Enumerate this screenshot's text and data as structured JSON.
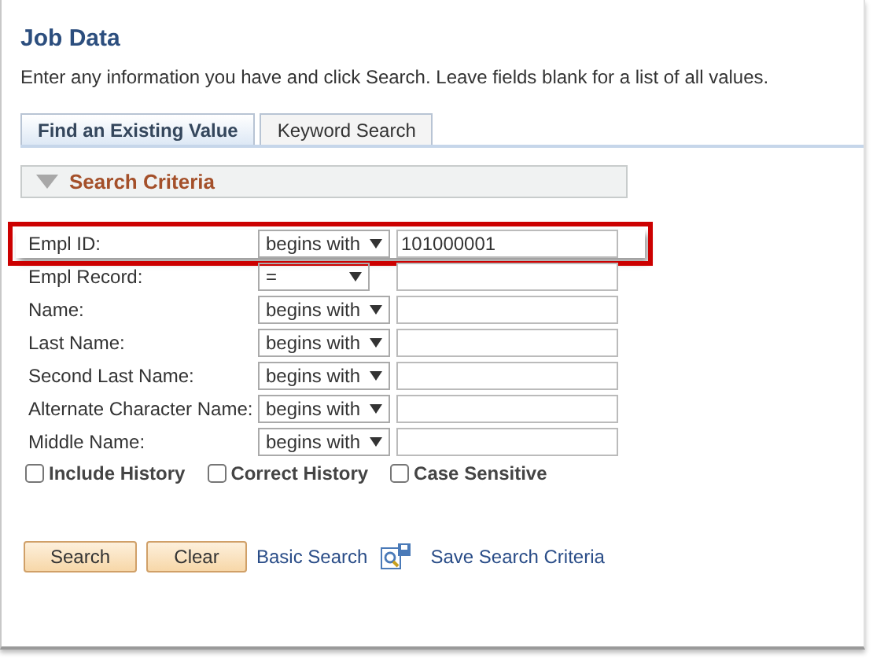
{
  "page": {
    "title": "Job Data",
    "instructions": "Enter any information you have and click Search. Leave fields blank for a list of all values."
  },
  "tabs": [
    {
      "label": "Find an Existing Value",
      "selected": true
    },
    {
      "label": "Keyword Search",
      "selected": false
    }
  ],
  "section": {
    "title": "Search Criteria",
    "expanded": true
  },
  "fields": [
    {
      "label": "Empl ID:",
      "operator": "begins with",
      "kind": "wide",
      "value": "101000001",
      "highlighted": true
    },
    {
      "label": "Empl Record:",
      "operator": "=",
      "kind": "narrow",
      "highlighted": false
    },
    {
      "label": "Name:",
      "operator": "begins with",
      "kind": "wide",
      "highlighted": false
    },
    {
      "label": "Last Name:",
      "operator": "begins with",
      "kind": "wide",
      "highlighted": false
    },
    {
      "label": "Second Last Name:",
      "operator": "begins with",
      "kind": "wide",
      "highlighted": false
    },
    {
      "label": "Alternate Character Name:",
      "operator": "begins with",
      "kind": "wide",
      "highlighted": false
    },
    {
      "label": "Middle Name:",
      "operator": "begins with",
      "kind": "wide",
      "highlighted": false
    }
  ],
  "options": [
    {
      "label": "Include History",
      "checked": false
    },
    {
      "label": "Correct History",
      "checked": false
    },
    {
      "label": "Case Sensitive",
      "checked": false
    }
  ],
  "buttons": [
    "Search",
    "Clear"
  ],
  "links": {
    "basic_search": "Basic Search",
    "save_search": "Save Search Criteria"
  }
}
